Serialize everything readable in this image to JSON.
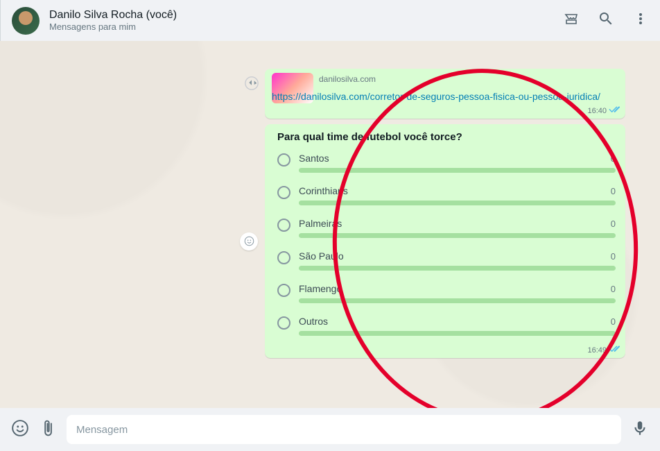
{
  "header": {
    "contact_name": "Danilo Silva Rocha (você)",
    "subtitle": "Mensagens para mim"
  },
  "messages": {
    "link": {
      "domain": "danilosilva.com",
      "url": "https://danilosilva.com/corretor-de-seguros-pessoa-fisica-ou-pessoa-juridica/",
      "time": "16:40"
    },
    "poll": {
      "question": "Para qual time de futebol você torce?",
      "options": [
        {
          "label": "Santos",
          "count": "0"
        },
        {
          "label": "Corinthians",
          "count": "0"
        },
        {
          "label": "Palmeiras",
          "count": "0"
        },
        {
          "label": "São Paulo",
          "count": "0"
        },
        {
          "label": "Flamengo",
          "count": "0"
        },
        {
          "label": "Outros",
          "count": "0"
        }
      ],
      "time": "16:49"
    }
  },
  "input": {
    "placeholder": "Mensagem"
  }
}
